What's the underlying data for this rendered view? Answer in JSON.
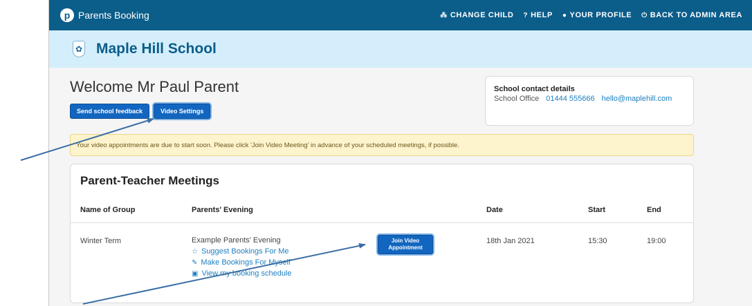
{
  "topbar": {
    "brand": "Parents Booking",
    "nav": [
      {
        "label": "CHANGE CHILD",
        "icon": "users-icon",
        "glyph": "⁂"
      },
      {
        "label": "HELP",
        "icon": "help-icon",
        "glyph": "?"
      },
      {
        "label": "YOUR PROFILE",
        "icon": "user-icon",
        "glyph": "●"
      },
      {
        "label": "BACK TO ADMIN AREA",
        "icon": "power-icon",
        "glyph": "⏻"
      }
    ]
  },
  "school": {
    "name": "Maple Hill School"
  },
  "welcome": "Welcome Mr Paul Parent",
  "buttons": {
    "feedback": "Send school feedback",
    "video_settings": "Video Settings"
  },
  "contact": {
    "title": "School contact details",
    "office_label": "School Office",
    "phone": "01444 555666",
    "email": "hello@maplehill.com"
  },
  "alert": "Your video appointments are due to start soon. Please click 'Join Video Meeting' in advance of your scheduled meetings, if possible.",
  "meetings": {
    "title": "Parent-Teacher Meetings",
    "columns": [
      "Name of Group",
      "Parents' Evening",
      "Date",
      "Start",
      "End"
    ],
    "row": {
      "group": "Winter Term",
      "evening": "Example Parents' Evening",
      "links": [
        "Suggest Bookings For Me",
        "Make Bookings For Myself",
        "View my booking schedule"
      ],
      "join_button": [
        "Join Video",
        "Appointment"
      ],
      "date": "18th Jan 2021",
      "start": "15:30",
      "end": "19:00"
    }
  },
  "colors": {
    "topbar": "#0b5d8a",
    "schoolbar": "#d5eefb",
    "button": "#1266c0",
    "link": "#1c7fc1",
    "alert_bg": "#fdf3cc",
    "arrow": "#3a6ea5"
  }
}
